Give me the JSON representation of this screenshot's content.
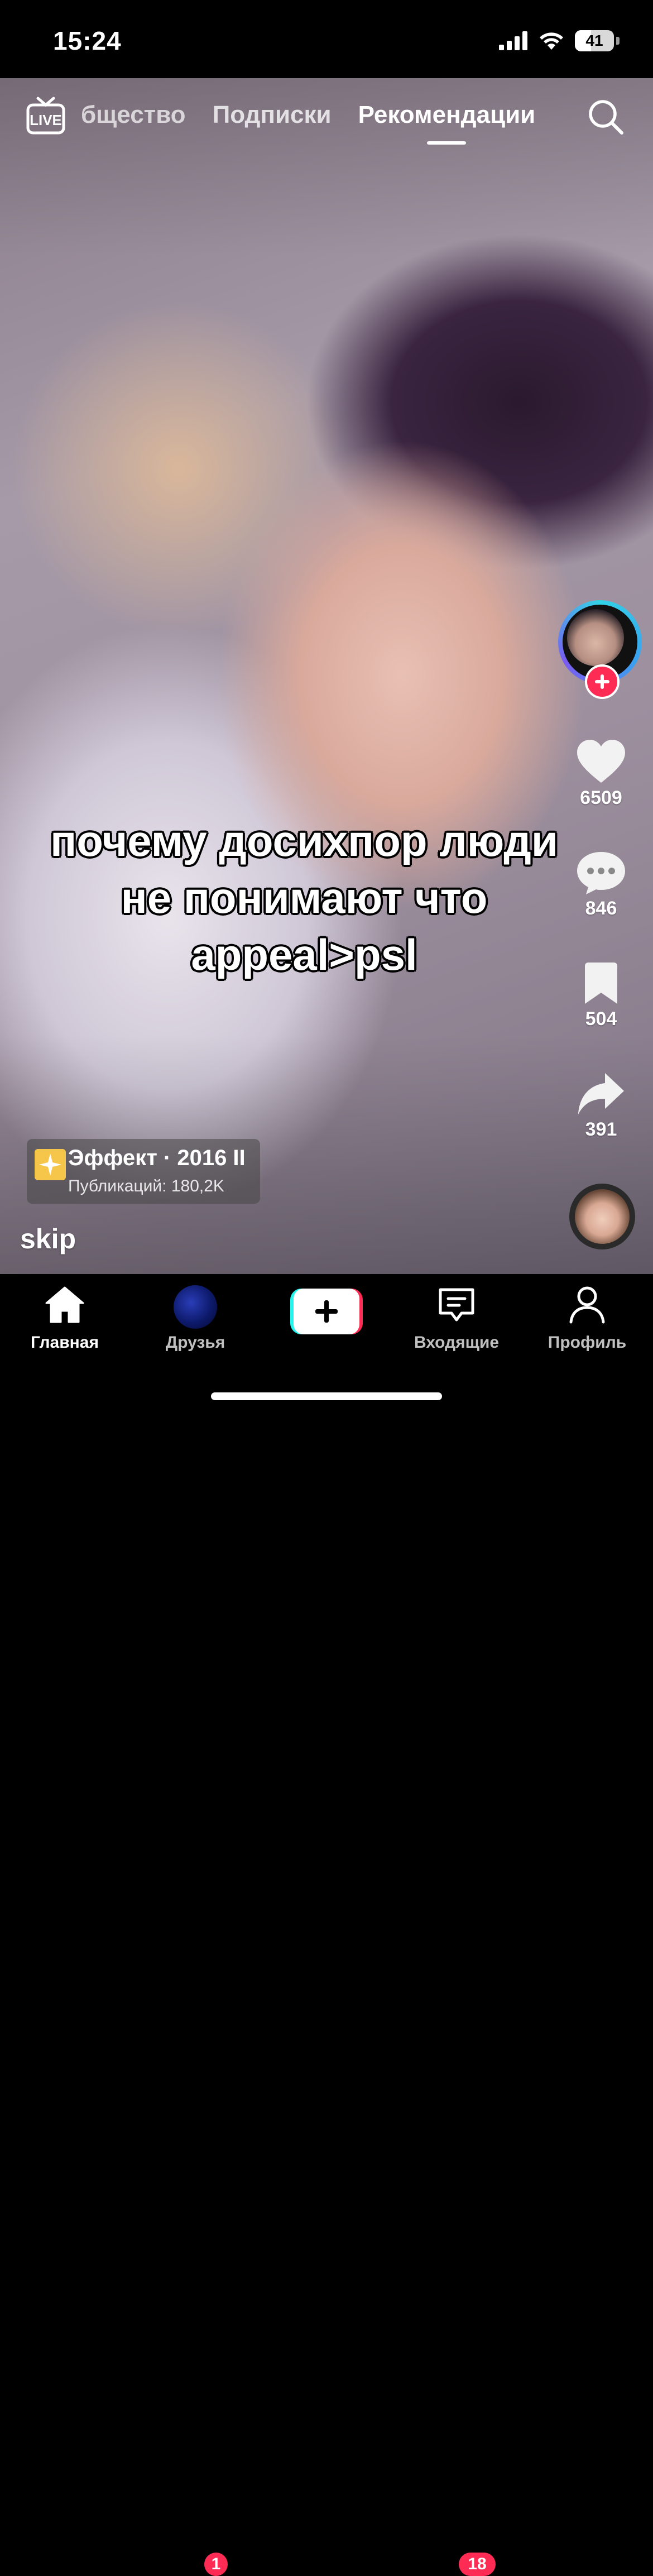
{
  "status_bar": {
    "time": "15:24",
    "battery_level": "41"
  },
  "top_nav": {
    "live_label": "LIVE",
    "tabs": [
      {
        "label": "бщество",
        "active": false
      },
      {
        "label": "Подписки",
        "active": false
      },
      {
        "label": "Рекомендации",
        "active": true
      }
    ]
  },
  "video": {
    "caption_lines": [
      "почему досихпор люди",
      "не понимают что",
      "appeal>psl"
    ]
  },
  "actions": {
    "likes": "6509",
    "comments": "846",
    "bookmarks": "504",
    "shares": "391"
  },
  "effect": {
    "title": "Эффект · 2016 II",
    "subtitle": "Публикаций: 180,2K"
  },
  "author": {
    "username": "skip"
  },
  "tabbar": {
    "home": "Главная",
    "friends": "Друзья",
    "friends_badge": "1",
    "inbox": "Входящие",
    "inbox_badge": "18",
    "profile": "Профиль"
  },
  "colors": {
    "accent": "#fe2c55",
    "cyan": "#25f4ee",
    "effect_yellow": "#f6c64a"
  }
}
